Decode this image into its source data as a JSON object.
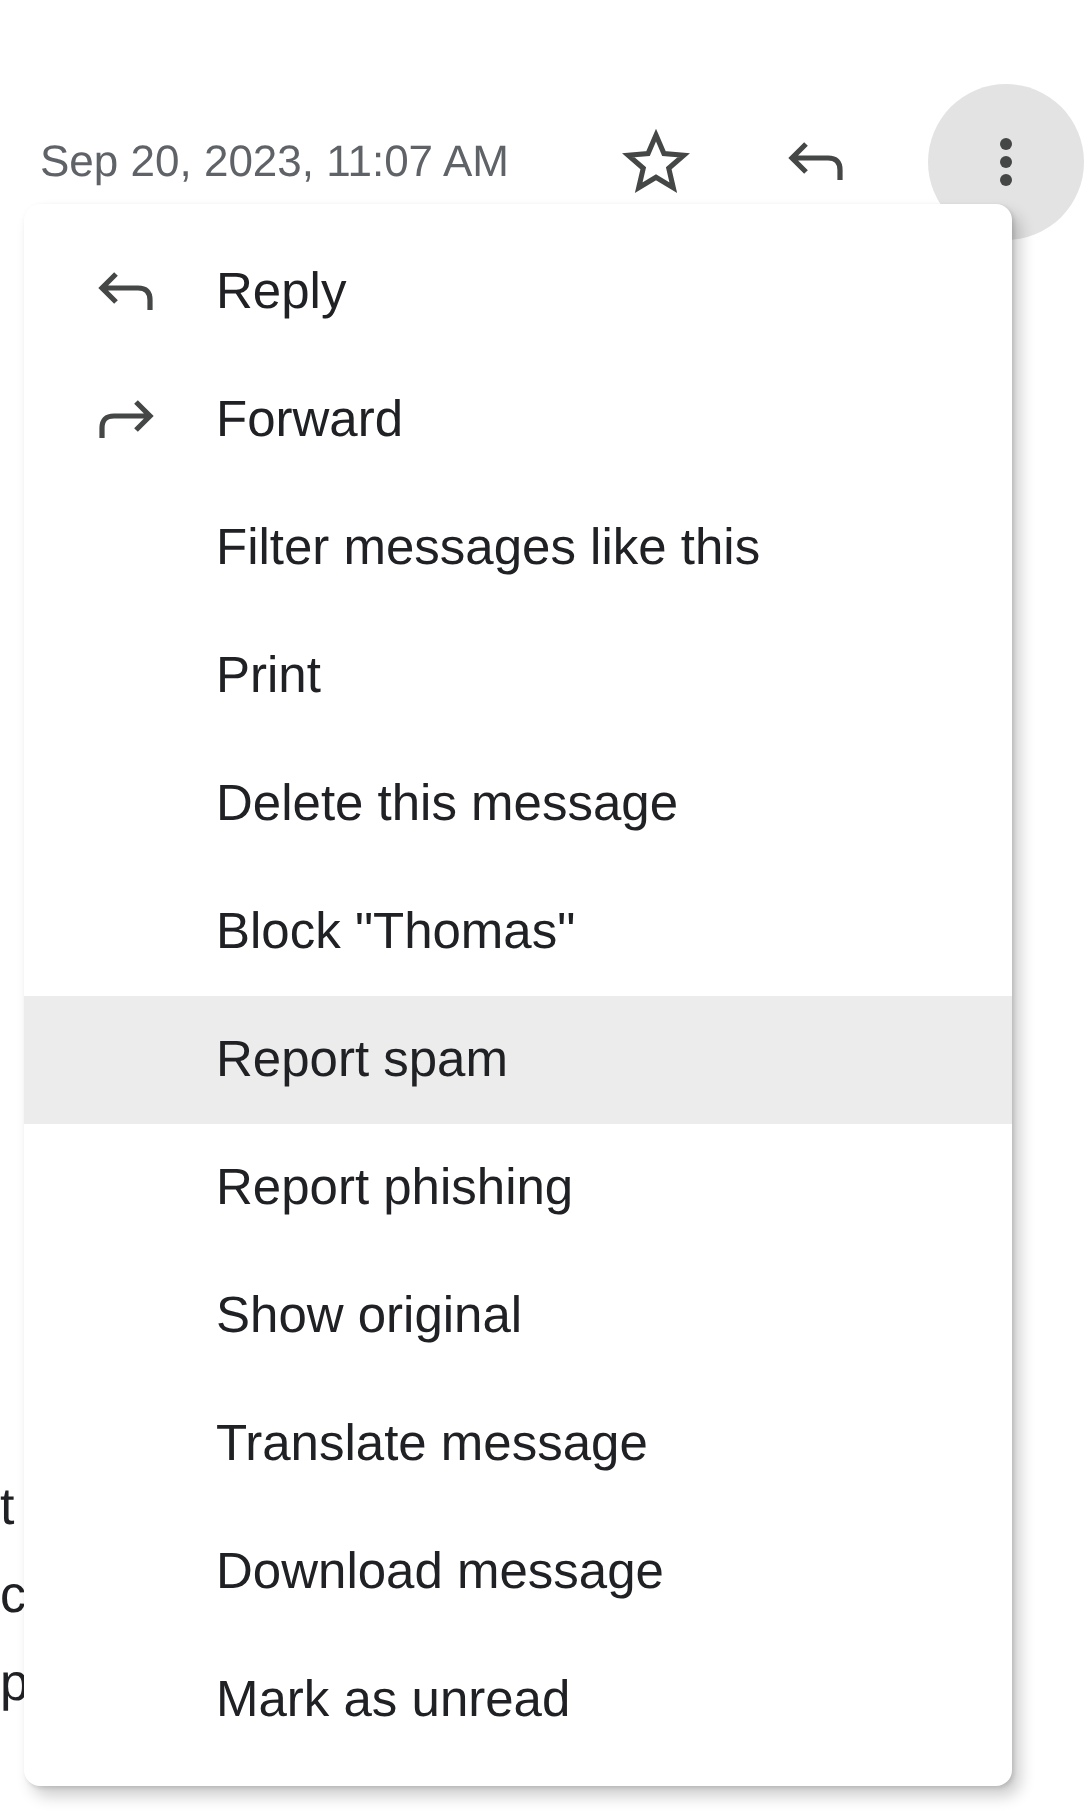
{
  "header": {
    "date": "Sep 20, 2023, 11:07 AM",
    "more_button": {
      "pressed": true
    }
  },
  "menu": {
    "items": [
      {
        "label": "Reply",
        "kind": "reply",
        "highlighted": false
      },
      {
        "label": "Forward",
        "kind": "forward",
        "highlighted": false
      },
      {
        "label": "Filter messages like this",
        "kind": "plain",
        "highlighted": false
      },
      {
        "label": "Print",
        "kind": "plain",
        "highlighted": false
      },
      {
        "label": "Delete this message",
        "kind": "plain",
        "highlighted": false
      },
      {
        "label": "Block \"Thomas\"",
        "kind": "plain",
        "highlighted": false
      },
      {
        "label": "Report spam",
        "kind": "plain",
        "highlighted": true
      },
      {
        "label": "Report phishing",
        "kind": "plain",
        "highlighted": false
      },
      {
        "label": "Show original",
        "kind": "plain",
        "highlighted": false
      },
      {
        "label": "Translate message",
        "kind": "plain",
        "highlighted": false
      },
      {
        "label": "Download message",
        "kind": "plain",
        "highlighted": false
      },
      {
        "label": "Mark as unread",
        "kind": "plain",
        "highlighted": false
      }
    ]
  },
  "body_fragments": [
    "t",
    "c",
    "p"
  ]
}
